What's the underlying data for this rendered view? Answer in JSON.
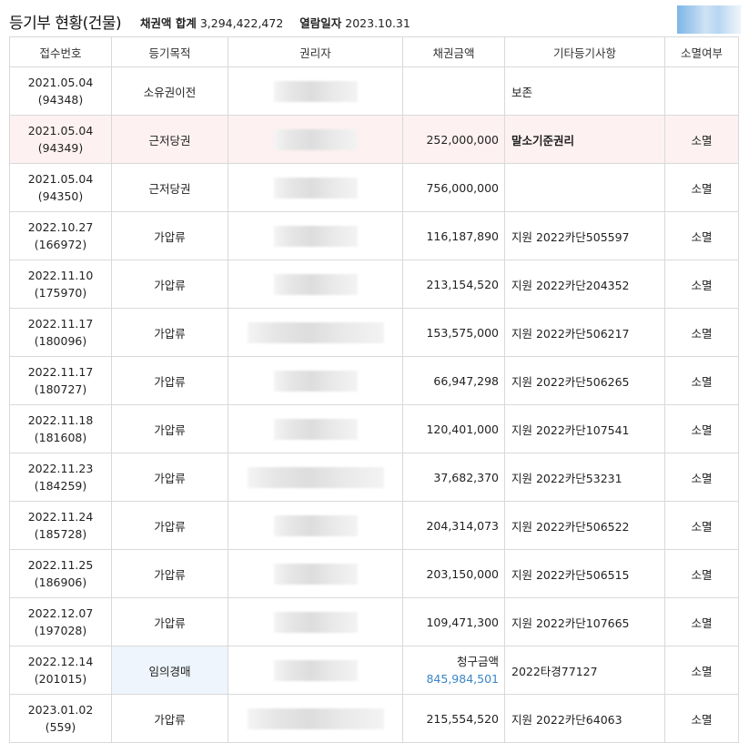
{
  "header": {
    "title": "등기부 현황(건물)",
    "sum_label": "채권액 합계",
    "sum_value": "3,294,422,472",
    "date_label": "열람일자",
    "date_value": "2023.10.31"
  },
  "table": {
    "columns": [
      "접수번호",
      "등기목적",
      "권리자",
      "채권금액",
      "기타등기사항",
      "소멸여부"
    ],
    "rows": [
      {
        "date": "2021.05.04",
        "no": "(94348)",
        "purpose": "소유권이전",
        "amount": "",
        "etc": "보존",
        "status": ""
      },
      {
        "date": "2021.05.04",
        "no": "(94349)",
        "purpose": "근저당권",
        "amount": "252,000,000",
        "etc": "말소기준권리",
        "status": "소멸"
      },
      {
        "date": "2021.05.04",
        "no": "(94350)",
        "purpose": "근저당권",
        "amount": "756,000,000",
        "etc": "",
        "status": "소멸"
      },
      {
        "date": "2022.10.27",
        "no": "(166972)",
        "purpose": "가압류",
        "amount": "116,187,890",
        "etc": "지원 2022카단505597",
        "status": "소멸"
      },
      {
        "date": "2022.11.10",
        "no": "(175970)",
        "purpose": "가압류",
        "amount": "213,154,520",
        "etc": "지원 2022카단204352",
        "status": "소멸"
      },
      {
        "date": "2022.11.17",
        "no": "(180096)",
        "purpose": "가압류",
        "amount": "153,575,000",
        "etc": "지원 2022카단506217",
        "status": "소멸"
      },
      {
        "date": "2022.11.17",
        "no": "(180727)",
        "purpose": "가압류",
        "amount": "66,947,298",
        "etc": "지원 2022카단506265",
        "status": "소멸"
      },
      {
        "date": "2022.11.18",
        "no": "(181608)",
        "purpose": "가압류",
        "amount": "120,401,000",
        "etc": "지원 2022카단107541",
        "status": "소멸"
      },
      {
        "date": "2022.11.23",
        "no": "(184259)",
        "purpose": "가압류",
        "amount": "37,682,370",
        "etc": "지원 2022카단53231",
        "status": "소멸"
      },
      {
        "date": "2022.11.24",
        "no": "(185728)",
        "purpose": "가압류",
        "amount": "204,314,073",
        "etc": "지원 2022카단506522",
        "status": "소멸"
      },
      {
        "date": "2022.11.25",
        "no": "(186906)",
        "purpose": "가압류",
        "amount": "203,150,000",
        "etc": "지원 2022카단506515",
        "status": "소멸"
      },
      {
        "date": "2022.12.07",
        "no": "(197028)",
        "purpose": "가압류",
        "amount": "109,471,300",
        "etc": "지원 2022카단107665",
        "status": "소멸"
      },
      {
        "date": "2022.12.14",
        "no": "(201015)",
        "purpose": "임의경매",
        "claim_label": "청구금액",
        "amount": "845,984,501",
        "etc": "2022타경77127",
        "status": "소멸"
      },
      {
        "date": "2023.01.02",
        "no": "(559)",
        "purpose": "가압류",
        "amount": "215,554,520",
        "etc": "지원 2022카단64063",
        "status": "소멸"
      }
    ]
  },
  "colors": {
    "highlight_row": "#fdf1f1",
    "auction_cell": "#eef5fc",
    "claim_amount": "#3a86c6"
  }
}
